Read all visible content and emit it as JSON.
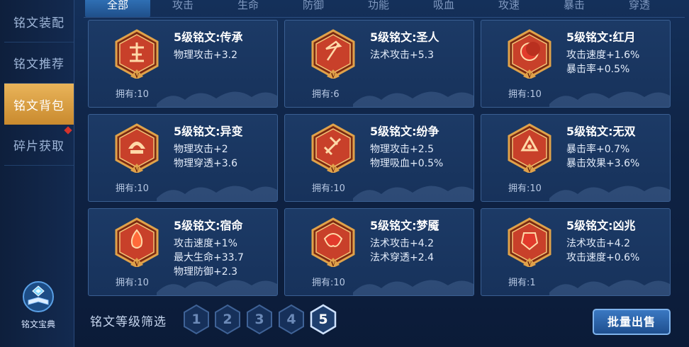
{
  "sidebar": {
    "items": [
      {
        "label": "铭文装配"
      },
      {
        "label": "铭文推荐"
      },
      {
        "label": "铭文背包"
      },
      {
        "label": "碎片获取"
      }
    ],
    "active_index": 2,
    "codex_label": "铭文宝典"
  },
  "tabs": [
    {
      "label": "全部"
    },
    {
      "label": "攻击"
    },
    {
      "label": "生命"
    },
    {
      "label": "防御"
    },
    {
      "label": "功能"
    },
    {
      "label": "吸血"
    },
    {
      "label": "攻速"
    },
    {
      "label": "暴击"
    },
    {
      "label": "穿透"
    }
  ],
  "active_tab": 0,
  "inscriptions": [
    {
      "title": "5级铭文:传承",
      "stats": [
        "物理攻击+3.2"
      ],
      "count": "拥有:10",
      "icon": "chuancheng-rune-icon"
    },
    {
      "title": "5级铭文:圣人",
      "stats": [
        "法术攻击+5.3"
      ],
      "count": "拥有:6",
      "icon": "shengren-rune-icon"
    },
    {
      "title": "5级铭文:红月",
      "stats": [
        "攻击速度+1.6%",
        "暴击率+0.5%"
      ],
      "count": "拥有:10",
      "icon": "hongyue-rune-icon"
    },
    {
      "title": "5级铭文:异变",
      "stats": [
        "物理攻击+2",
        "物理穿透+3.6"
      ],
      "count": "拥有:10",
      "icon": "yibian-rune-icon"
    },
    {
      "title": "5级铭文:纷争",
      "stats": [
        "物理攻击+2.5",
        "物理吸血+0.5%"
      ],
      "count": "拥有:10",
      "icon": "fenzheng-rune-icon"
    },
    {
      "title": "5级铭文:无双",
      "stats": [
        "暴击率+0.7%",
        "暴击效果+3.6%"
      ],
      "count": "拥有:10",
      "icon": "wushuang-rune-icon"
    },
    {
      "title": "5级铭文:宿命",
      "stats": [
        "攻击速度+1%",
        "最大生命+33.7",
        "物理防御+2.3"
      ],
      "count": "拥有:10",
      "icon": "suming-rune-icon"
    },
    {
      "title": "5级铭文:梦魇",
      "stats": [
        "法术攻击+4.2",
        "法术穿透+2.4"
      ],
      "count": "拥有:10",
      "icon": "mengyan-rune-icon"
    },
    {
      "title": "5级铭文:凶兆",
      "stats": [
        "法术攻击+4.2",
        "攻击速度+0.6%"
      ],
      "count": "拥有:1",
      "icon": "xiongzhao-rune-icon"
    }
  ],
  "rune_level_mark": "V",
  "filter": {
    "label": "铭文等级筛选",
    "levels": [
      "1",
      "2",
      "3",
      "4",
      "5"
    ],
    "selected": "5"
  },
  "sell_button": "批量出售",
  "colors": {
    "accent_gold": "#e0a24a",
    "rune_red": "#c8402a",
    "panel_blue": "#1c3a66"
  }
}
